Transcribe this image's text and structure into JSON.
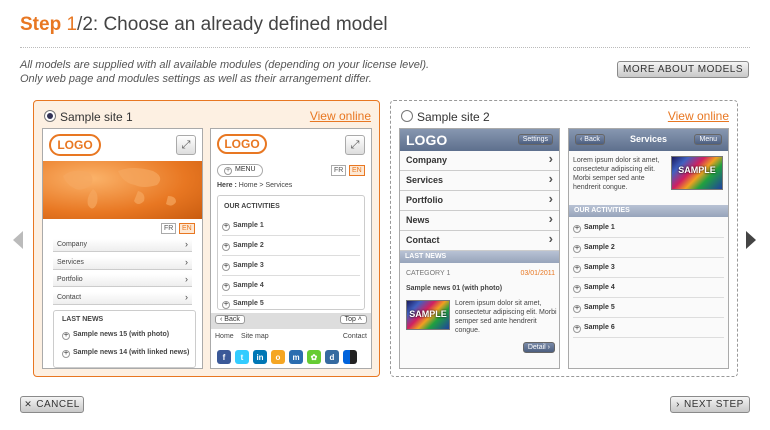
{
  "header": {
    "step_word": "Step",
    "step_num": "1",
    "step_total": "/2",
    "title": ": Choose an already defined model",
    "intro_1": "All models are supplied with all available modules (depending on your license level).",
    "intro_2": "Only web page and modules settings as well as their arrangement differ.",
    "more_btn": "MORE ABOUT MODELS"
  },
  "footer": {
    "cancel": "CANCEL",
    "next": "NEXT STEP"
  },
  "colors": {
    "accent": "#e87722",
    "selected_bg": "#fdf0e2",
    "mobile_header": "#5d6f8d"
  },
  "site1": {
    "label": "Sample site 1",
    "view_online": "View online",
    "selected": true,
    "logo": "LOGO",
    "lang_fr": "FR",
    "lang_en": "EN",
    "menu": [
      "Company",
      "Services",
      "Portfolio",
      "Contact"
    ],
    "last_news": "LAST NEWS",
    "news": [
      "Sample news 15 (with photo)",
      "Sample news 14 (with linked news)"
    ],
    "phone2": {
      "menu": "MENU",
      "here": "Here :",
      "crumb": "Home > Services",
      "activities": "OUR ACTIVITIES",
      "items": [
        "Sample 1",
        "Sample 2",
        "Sample 3",
        "Sample 4",
        "Sample 5"
      ],
      "back": "Back",
      "top": "Top",
      "home": "Home",
      "sitemap": "Site map",
      "contact": "Contact"
    }
  },
  "site2": {
    "label": "Sample site 2",
    "view_online": "View online",
    "selected": false,
    "logo": "LOGO",
    "settings": "Settings",
    "menu": [
      "Company",
      "Services",
      "Portfolio",
      "News",
      "Contact"
    ],
    "last_news": "LAST NEWS",
    "category": "CATEGORY 1",
    "date": "03/01/2011",
    "news_title": "Sample news 01 (with photo)",
    "lorem": "Lorem ipsum dolor sit amet, consectetur adipiscing elit. Morbi semper sed ante hendrerit congue.",
    "detail": "Detail",
    "sample": "SAMPLE",
    "phone2": {
      "back": "Back",
      "title": "Services",
      "menu": "Menu",
      "activities": "OUR ACTIVITIES",
      "items": [
        "Sample 1",
        "Sample 2",
        "Sample 3",
        "Sample 4",
        "Sample 5",
        "Sample 6"
      ]
    }
  }
}
